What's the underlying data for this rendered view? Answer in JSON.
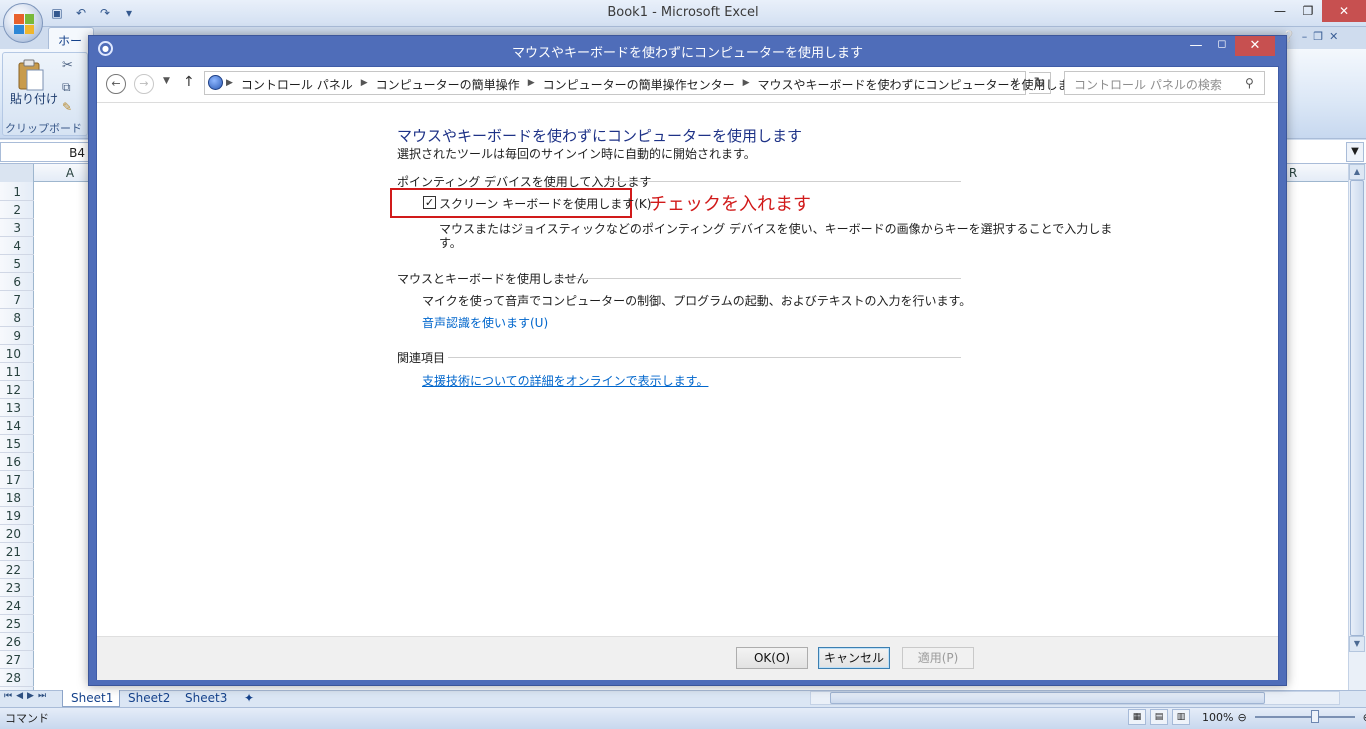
{
  "excel": {
    "title": "Book1 - Microsoft Excel",
    "tab_home": "ホーム",
    "paste_label": "貼り付け",
    "clipboard_group": "クリップボード",
    "name_box": "B4",
    "columns": [
      "A",
      "R"
    ],
    "rows": [
      "1",
      "2",
      "3",
      "4",
      "5",
      "6",
      "7",
      "8",
      "9",
      "10",
      "11",
      "12",
      "13",
      "14",
      "15",
      "16",
      "17",
      "18",
      "19",
      "20",
      "21",
      "22",
      "23",
      "24",
      "25",
      "26",
      "27",
      "28"
    ],
    "sheets": [
      "Sheet1",
      "Sheet2",
      "Sheet3"
    ],
    "status_mode": "コマンド",
    "zoom": "100%"
  },
  "dialog": {
    "title": "マウスやキーボードを使わずにコンピューターを使用します",
    "breadcrumbs": [
      "コントロール パネル",
      "コンピューターの簡単操作",
      "コンピューターの簡単操作センター",
      "マウスやキーボードを使わずにコンピューターを使用します"
    ],
    "search_placeholder": "コントロール パネルの検索",
    "heading": "マウスやキーボードを使わずにコンピューターを使用します",
    "subheading": "選択されたツールは毎回のサインイン時に自動的に開始されます。",
    "section1": {
      "title": "ポインティング デバイスを使用して入力します",
      "checkbox_label": "スクリーン キーボードを使用します(K)",
      "checked": true,
      "desc_line1": "マウスまたはジョイスティックなどのポインティング デバイスを使い、キーボードの画像からキーを選択することで入力しま",
      "desc_line2": "す。"
    },
    "section2": {
      "title": "マウスとキーボードを使用しません",
      "desc": "マイクを使って音声でコンピューターの制御、プログラムの起動、およびテキストの入力を行います。",
      "link": "音声認識を使います(U)"
    },
    "section3": {
      "title": "関連項目",
      "link": "支援技術についての詳細をオンラインで表示します。"
    },
    "annotation": "チェックを入れます",
    "buttons": {
      "ok": "OK(O)",
      "cancel": "キャンセル",
      "apply": "適用(P)"
    }
  },
  "colors": {
    "accent": "#4f6db9",
    "annotation": "#d11a1a",
    "link": "#0066cc",
    "heading": "#1e3287"
  }
}
